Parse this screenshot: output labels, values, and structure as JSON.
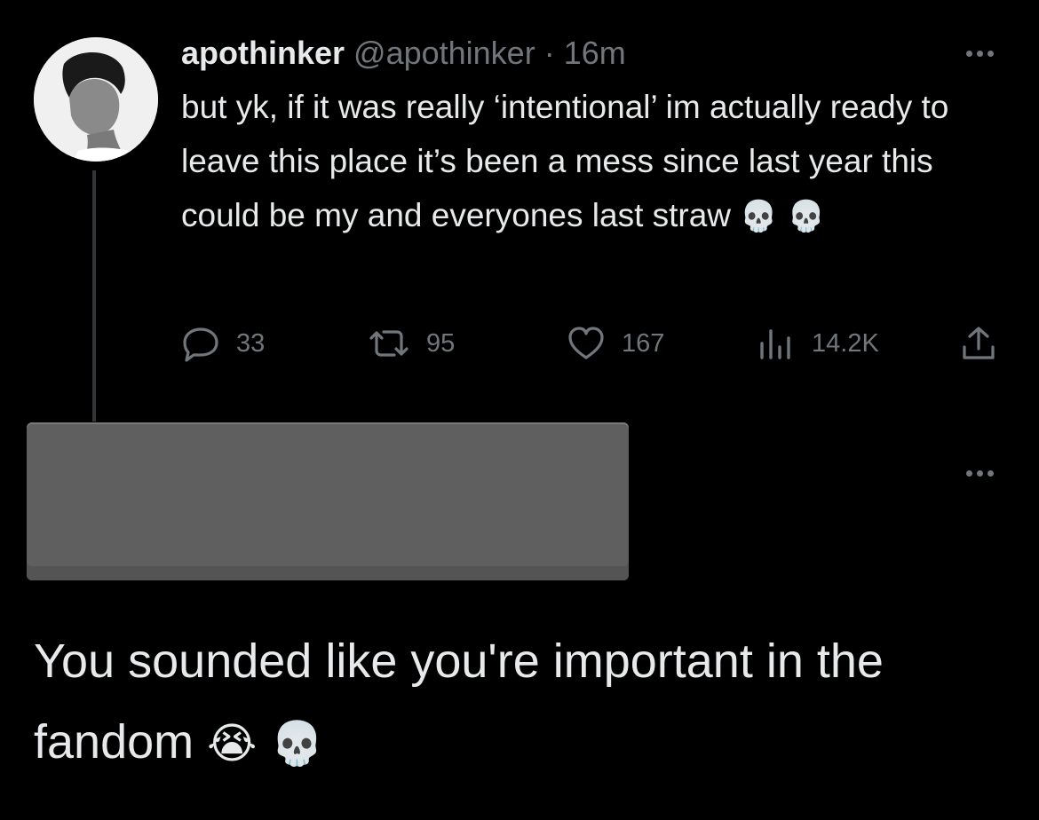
{
  "tweet": {
    "display_name": "apothinker",
    "handle": "@apothinker",
    "separator": "·",
    "time": "16m",
    "text": "but yk, if it was really ‘intentional’ im actually ready to leave this place it’s been a mess since last year this could be my and everyones last straw",
    "emoji": "💀 💀",
    "stats": {
      "replies": "33",
      "retweets": "95",
      "likes": "167",
      "views": "14.2K"
    }
  },
  "reply": {
    "text": "You sounded like you're important in the fandom",
    "emoji": "😭 💀"
  },
  "icons": {
    "reply": "reply-icon",
    "retweet": "retweet-icon",
    "like": "heart-icon",
    "views": "views-icon",
    "share": "share-icon",
    "more": "more-icon"
  }
}
